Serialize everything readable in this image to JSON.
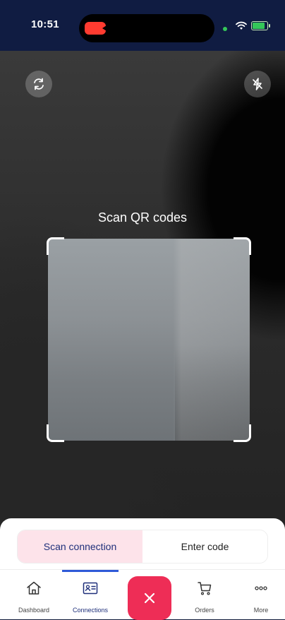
{
  "status_bar": {
    "time": "10:51"
  },
  "camera": {
    "title": "Scan QR codes",
    "switch_camera_icon": "switch-camera-icon",
    "flash_icon": "flash-off-icon"
  },
  "segmented_control": {
    "options": [
      {
        "label": "Scan connection",
        "active": true
      },
      {
        "label": "Enter code",
        "active": false
      }
    ]
  },
  "tab_bar": {
    "items": [
      {
        "label": "Dashboard",
        "icon": "home-icon",
        "active": false
      },
      {
        "label": "Connections",
        "icon": "id-card-icon",
        "active": true
      },
      {
        "label": "Orders",
        "icon": "cart-icon",
        "active": false
      },
      {
        "label": "More",
        "icon": "more-dots-icon",
        "active": false
      }
    ],
    "center_button_icon": "close-icon"
  },
  "colors": {
    "brand_navy": "#101c42",
    "accent_red": "#ee2d56",
    "active_segment_bg": "#fde3ea",
    "active_tab_indicator": "#2f5ad8"
  }
}
